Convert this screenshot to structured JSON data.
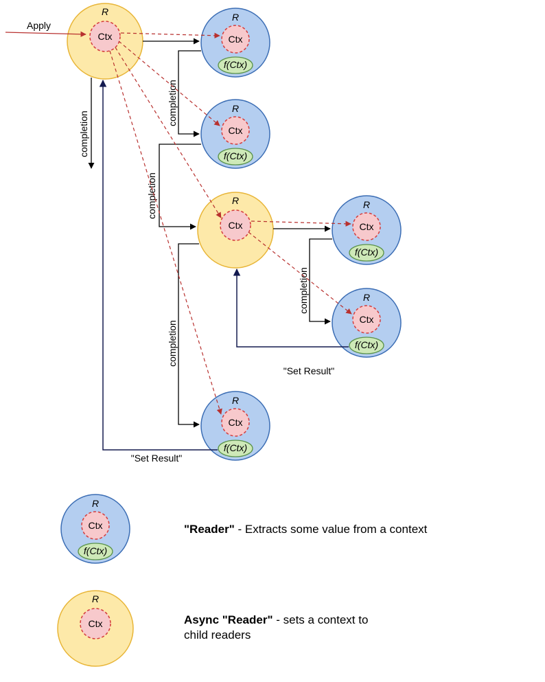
{
  "labels": {
    "apply": "Apply",
    "completion": "completion",
    "setResult": "\"Set Result\"",
    "R": "R",
    "Ctx": "Ctx",
    "fCtx": "f(Ctx)"
  },
  "legend": {
    "reader": {
      "title": "\"Reader\"",
      "desc": " - Extracts some value from a context"
    },
    "async": {
      "title": "Async \"Reader\"",
      "desc": " - sets a context to child readers"
    }
  },
  "colors": {
    "yellowFill": "#FDE9A9",
    "yellowStroke": "#E8B537",
    "blueFill": "#B4CEF0",
    "blueStroke": "#3B6DB4",
    "pinkFill": "#F7C9CC",
    "pinkStroke": "#D43C3C",
    "greenFill": "#CEE9B8",
    "greenStroke": "#5B934A",
    "redArrow": "#B8312F",
    "navyArrow": "#131A4F",
    "black": "#000000"
  }
}
